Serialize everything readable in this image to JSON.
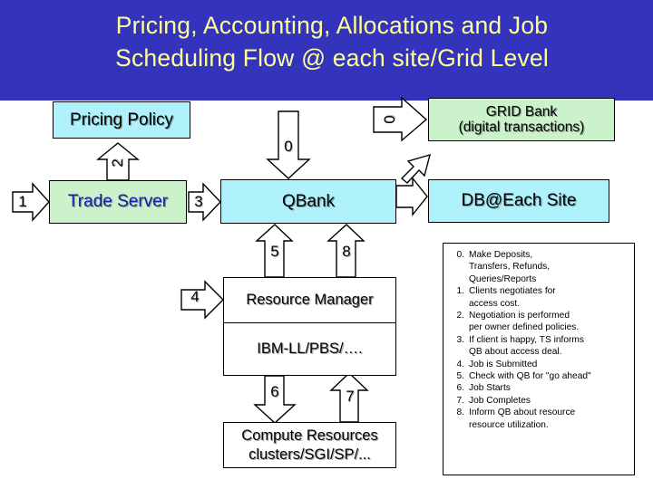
{
  "title": {
    "line1": "Pricing, Accounting, Allocations and Job",
    "line2": "Scheduling Flow @ each site/Grid Level",
    "color": "#ffff99",
    "background": "#3333bb"
  },
  "nodes": {
    "pricing_policy": {
      "label": "Pricing Policy",
      "fill": "#b0f2fb",
      "text_color": "#000000"
    },
    "trade_server": {
      "label": "Trade Server",
      "fill": "#ccf2cc",
      "text_color": "#1a1aaa"
    },
    "qbank": {
      "label": "QBank",
      "fill": "#b0f2fb",
      "text_color": "#000000"
    },
    "grid_bank": {
      "label_line1": "GRID Bank",
      "label_line2": "(digital transactions)",
      "fill": "#ccf2cc",
      "text_color": "#000000"
    },
    "db_each_site": {
      "label": "DB@Each Site",
      "fill": "#b0f2fb",
      "text_color": "#000000"
    },
    "resource_manager": {
      "label": "Resource Manager",
      "sublabel": "IBM-LL/PBS/….",
      "fill": "#ffffff",
      "text_color": "#000000"
    },
    "compute_resources": {
      "label_line1": "Compute Resources",
      "label_line2": "clusters/SGI/SP/...",
      "fill": "#ffffff",
      "text_color": "#000000"
    }
  },
  "arrows": {
    "a1": {
      "label": "1",
      "from": "client",
      "to": "trade_server",
      "direction": "right"
    },
    "a2": {
      "label": "2",
      "from": "trade_server",
      "to": "pricing_policy",
      "direction": "up"
    },
    "a3": {
      "label": "3",
      "from": "trade_server",
      "to": "qbank",
      "direction": "right"
    },
    "a0_down": {
      "label": "0",
      "from": "client",
      "to": "qbank",
      "direction": "down"
    },
    "a0_right": {
      "label": "0",
      "from": "qbank",
      "to": "grid_bank",
      "direction": "right"
    },
    "a_diag": {
      "label": "",
      "from": "qbank",
      "to": "grid_bank",
      "direction": "up-right"
    },
    "a_db": {
      "label": "",
      "from": "qbank",
      "to": "db_each_site",
      "direction": "right"
    },
    "a5": {
      "label": "5",
      "from": "resource_manager",
      "to": "qbank",
      "direction": "up"
    },
    "a8": {
      "label": "8",
      "from": "resource_manager",
      "to": "qbank",
      "direction": "up"
    },
    "a4": {
      "label": "4",
      "from": "client",
      "to": "resource_manager",
      "direction": "right"
    },
    "a6": {
      "label": "6",
      "from": "resource_manager",
      "to": "compute_resources",
      "direction": "down"
    },
    "a7": {
      "label": "7",
      "from": "compute_resources",
      "to": "resource_manager",
      "direction": "up"
    }
  },
  "legend": {
    "items": [
      {
        "num": "0.",
        "text": "Make Deposits,\nTransfers, Refunds,\nQueries/Reports"
      },
      {
        "num": "1.",
        "text": "Clients negotiates for\naccess cost."
      },
      {
        "num": "2.",
        "text": "Negotiation is performed\nper owner defined policies."
      },
      {
        "num": "3.",
        "text": "If client is happy, TS informs\nQB about access deal."
      },
      {
        "num": "4.",
        "text": "Job is Submitted"
      },
      {
        "num": "5.",
        "text": "Check with QB for \"go ahead\""
      },
      {
        "num": "6.",
        "text": "Job Starts"
      },
      {
        "num": "7.",
        "text": "Job Completes"
      },
      {
        "num": "8.",
        "text": "Inform QB about resource\nresource utilization."
      }
    ]
  }
}
